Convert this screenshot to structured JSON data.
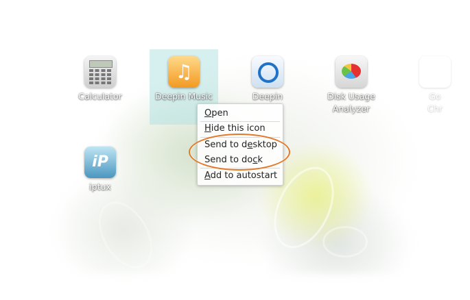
{
  "apps": [
    {
      "name": "Calculator",
      "icon": "calculator-icon"
    },
    {
      "name": "Deepin Music",
      "icon": "deepin-music-icon"
    },
    {
      "name": "Deepin",
      "icon": "deepin-icon"
    },
    {
      "name": "Disk Usage",
      "name2": "Analyzer",
      "icon": "disk-usage-analyzer-icon"
    },
    {
      "name": "iptux",
      "icon": "iptux-icon"
    },
    {
      "name": "Go",
      "name2": "Chr",
      "icon": "chrome-icon"
    }
  ],
  "context_menu": {
    "items": [
      {
        "pre": "",
        "key": "O",
        "post": "pen"
      },
      {
        "pre": "",
        "key": "H",
        "post": "ide this icon"
      },
      {
        "pre": "Send to d",
        "key": "e",
        "post": "sktop"
      },
      {
        "pre": "Send to do",
        "key": "c",
        "post": "k"
      },
      {
        "pre": "",
        "key": "A",
        "post": "dd to autostart"
      }
    ]
  },
  "colors": {
    "highlight_ring": "#e2782a",
    "selection": "#b4e1e1"
  }
}
